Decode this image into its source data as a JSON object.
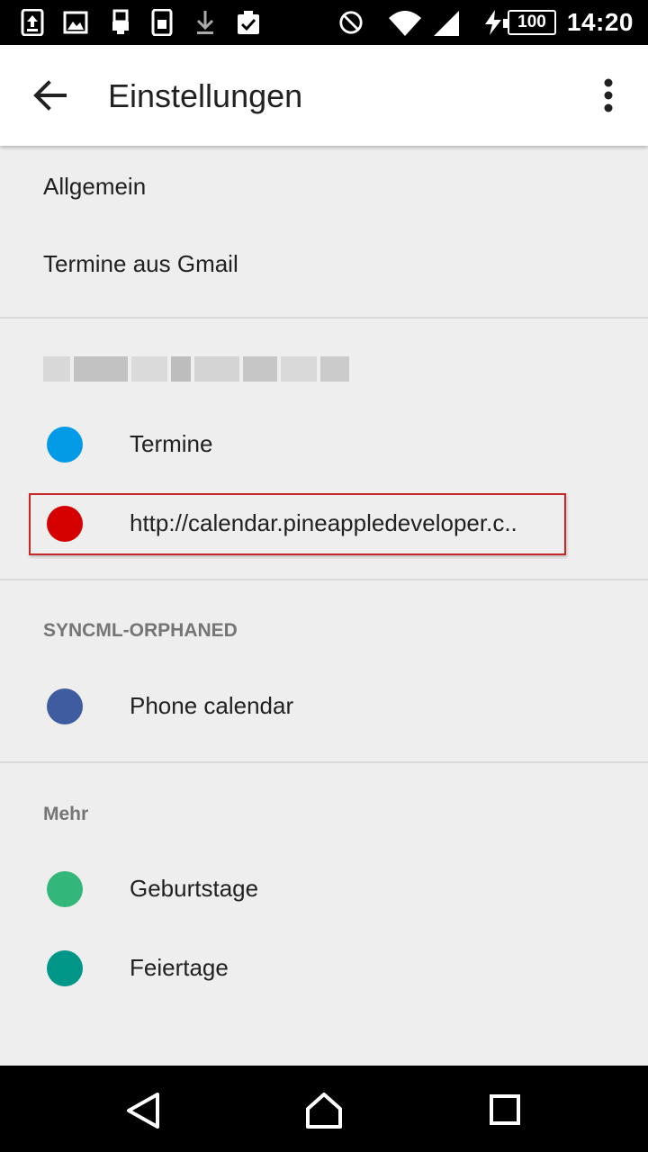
{
  "statusbar": {
    "time": "14:20",
    "battery": "100",
    "icons": [
      "upload-notification-icon",
      "image-icon",
      "usb-icon",
      "sim-icon",
      "download-icon",
      "clipboard-check-icon",
      "do-not-disturb-icon",
      "wifi-icon",
      "cell-signal-icon",
      "charging-icon"
    ]
  },
  "appbar": {
    "title": "Einstellungen",
    "back_icon": "arrow-back-icon",
    "more_icon": "more-vert-icon"
  },
  "menu": {
    "general": "Allgemein",
    "gmail_events": "Termine aus Gmail"
  },
  "account": {
    "calendars": [
      {
        "label": "Termine",
        "color": "#039be5"
      },
      {
        "label": "http://calendar.pineappledeveloper.c..",
        "color": "#d50000"
      }
    ]
  },
  "syncml": {
    "header": "SYNCML-ORPHANED",
    "calendars": [
      {
        "label": "Phone calendar",
        "color": "#3f5ca0"
      }
    ]
  },
  "more": {
    "header": "Mehr",
    "calendars": [
      {
        "label": "Geburtstage",
        "color": "#33b679"
      },
      {
        "label": "Feiertage",
        "color": "#009688"
      }
    ]
  },
  "colors": {
    "highlight_border": "#c62828"
  },
  "navbar": {
    "icons": [
      "back-triangle-icon",
      "home-icon",
      "recents-icon"
    ]
  }
}
